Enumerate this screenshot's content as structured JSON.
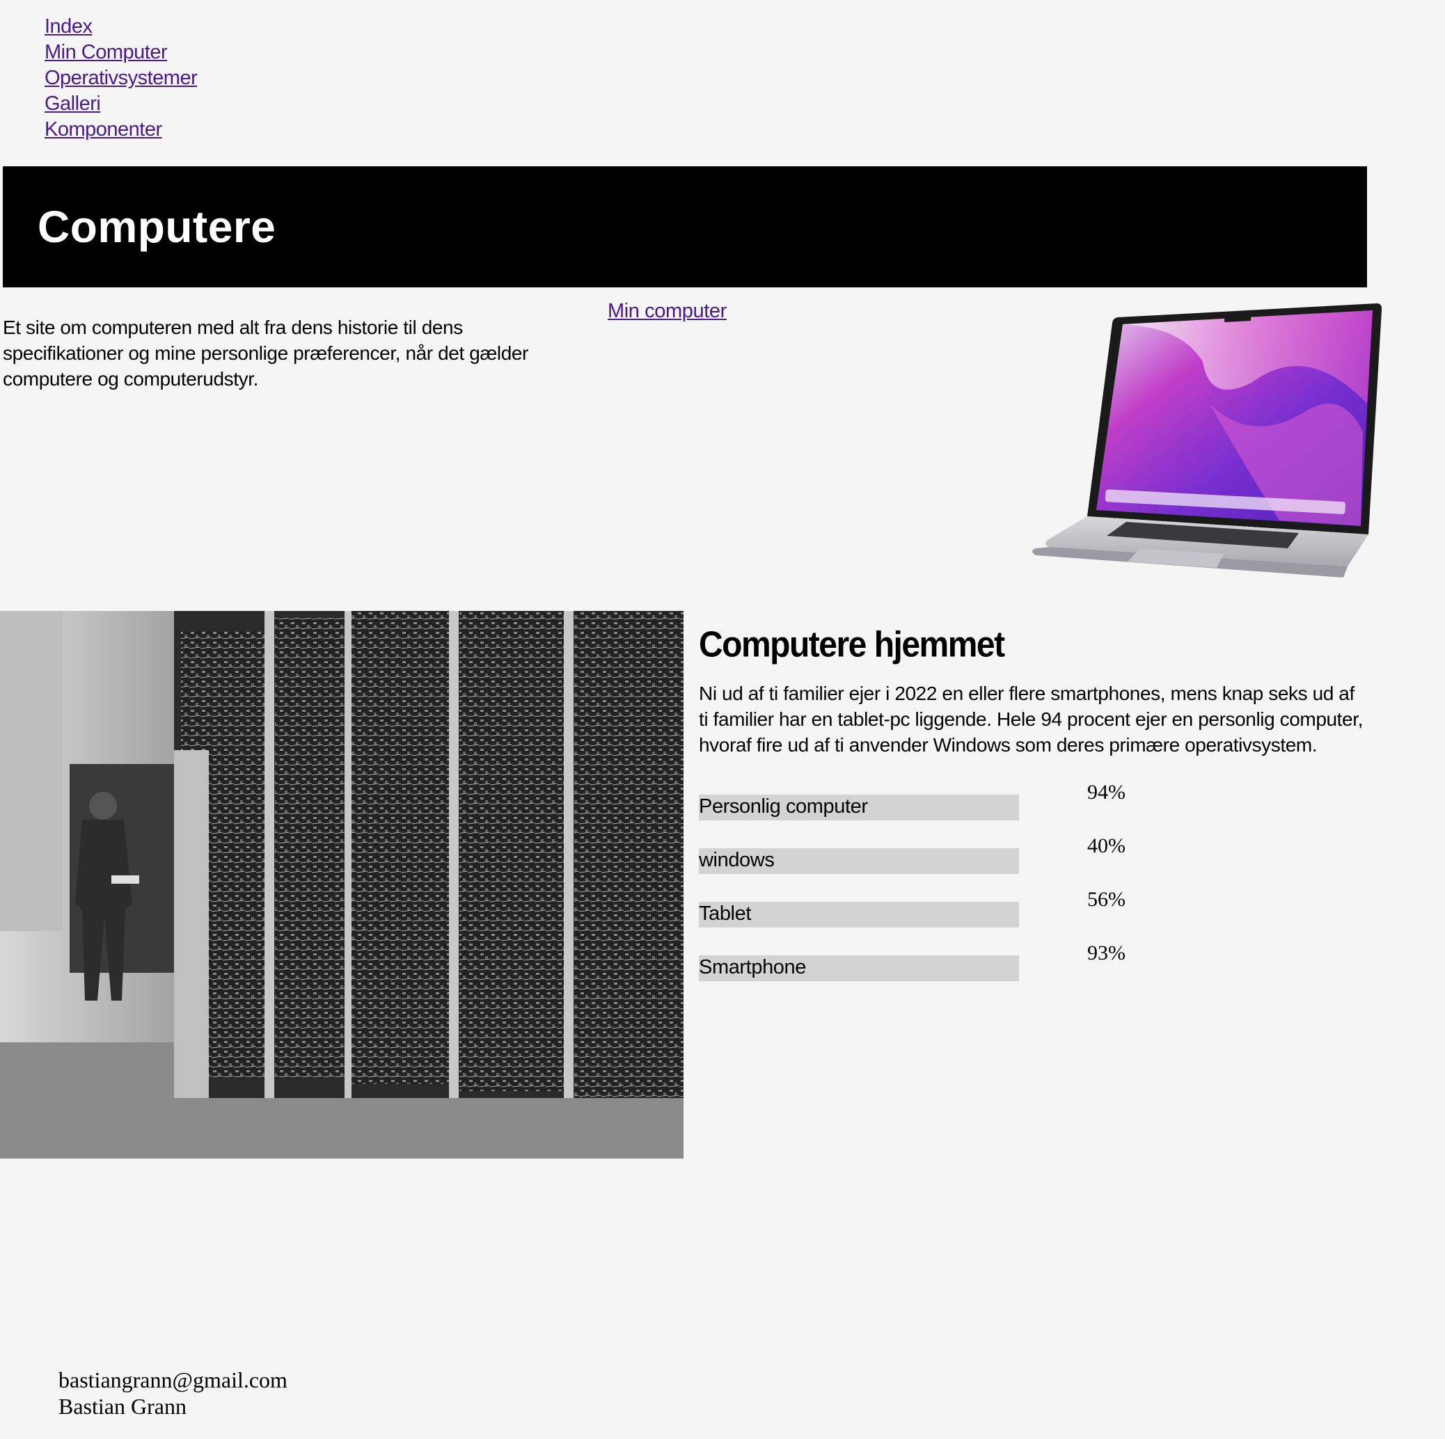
{
  "nav": {
    "items": [
      {
        "label": "Index"
      },
      {
        "label": "Min Computer"
      },
      {
        "label": "Operativsystemer"
      },
      {
        "label": "Galleri"
      },
      {
        "label": "Komponenter"
      }
    ]
  },
  "header": {
    "title": "Computere"
  },
  "intro": {
    "text": "Et site om computeren med alt fra dens historie til dens specifikationer og mine personlige præferencer, når det gælder computere og computerudstyr.",
    "link_label": "Min computer"
  },
  "stats": {
    "title": "Computere hjemmet",
    "text": "Ni ud af ti familier ejer i 2022 en eller flere smartphones, mens knap seks ud af ti familier har en tablet-pc liggende. Hele 94 procent ejer en personlig computer, hvoraf fire ud af ti anvender Windows som deres primære operativsystem.",
    "rows": [
      {
        "label": "Personlig computer",
        "value": "94%",
        "fraction": 0.94
      },
      {
        "label": "windows",
        "value": "40%",
        "fraction": 0.4
      },
      {
        "label": "Tablet",
        "value": "56%",
        "fraction": 0.56
      },
      {
        "label": "Smartphone",
        "value": "93%",
        "fraction": 0.93
      }
    ]
  },
  "footer": {
    "email": "bastiangrann@gmail.com",
    "name": "Bastian Grann"
  },
  "colors": {
    "background": "#f5f5f5",
    "header_bg": "#000000",
    "link": "#4a1a8a",
    "bar": "#d3d3d3"
  }
}
